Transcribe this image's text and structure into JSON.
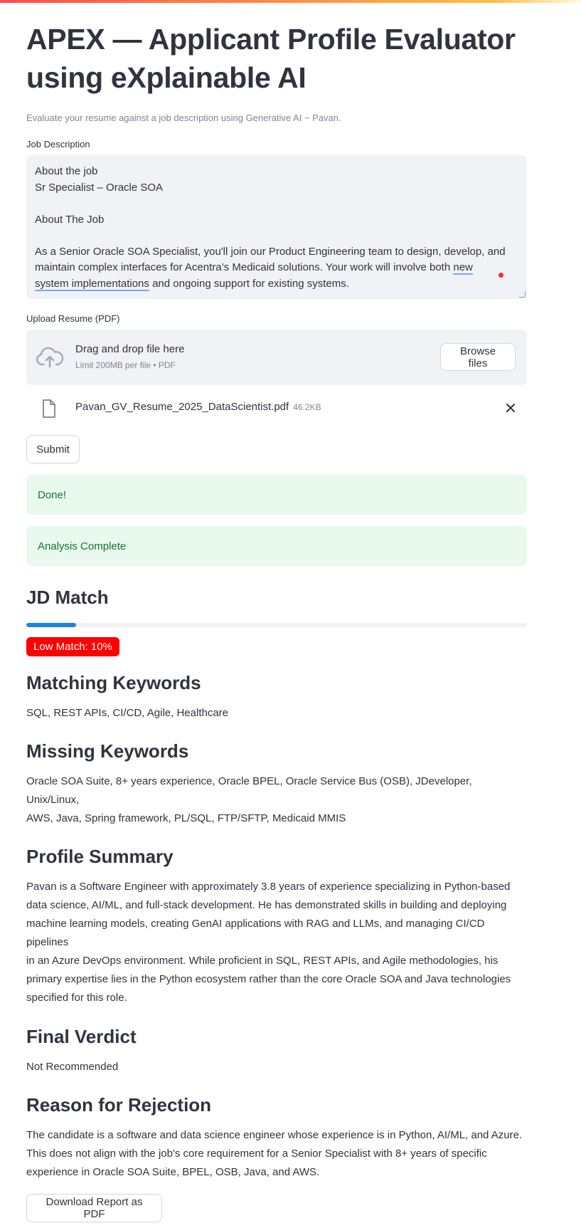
{
  "app": {
    "title": "APEX — Applicant Profile Evaluator using eXplainable AI",
    "caption": "Evaluate your resume against a job description using Generative AI ~ Pavan."
  },
  "job_description": {
    "label": "Job Description",
    "lines": [
      "About the job",
      "Sr Specialist – Oracle SOA",
      "",
      "About The Job",
      "",
      "As a Senior Oracle SOA Specialist, you'll join our Product Engineering team to design, develop, and",
      "maintain complex interfaces for Acentra’s Medicaid solutions. Your work will involve both",
      "new",
      "system implementations",
      "and ongoing support for existing systems."
    ]
  },
  "upload": {
    "label": "Upload Resume (PDF)",
    "drag_text": "Drag and drop file here",
    "limit_text": "Limit 200MB per file • PDF",
    "browse_label": "Browse files",
    "cloud_icon": "cloud-upload-icon",
    "file": {
      "name": "Pavan_GV_Resume_2025_DataScientist.pdf",
      "size": "46.2KB",
      "icon": "file-icon",
      "remove_icon": "close-icon"
    }
  },
  "submit_label": "Submit",
  "alerts": {
    "done": "Done!",
    "complete": "Analysis Complete"
  },
  "jd_match": {
    "heading": "JD Match",
    "progress_percent": 10,
    "badge": "Low Match: 10%",
    "badge_color": "#ff0000",
    "progress_color": "#1c83e1"
  },
  "matching_keywords": {
    "heading": "Matching Keywords",
    "text": "SQL, REST APIs, CI/CD, Agile, Healthcare"
  },
  "missing_keywords": {
    "heading": "Missing Keywords",
    "line1": "Oracle SOA Suite, 8+ years experience, Oracle BPEL, Oracle Service Bus (OSB), JDeveloper, Unix/Linux,",
    "line2": "AWS, Java, Spring framework, PL/SQL, FTP/SFTP, Medicaid MMIS"
  },
  "profile_summary": {
    "heading": "Profile Summary",
    "lines": [
      "Pavan is a Software Engineer with approximately 3.8 years of experience specializing in Python-based",
      "data science, AI/ML, and full-stack development. He has demonstrated skills in building and deploying",
      "machine learning models, creating GenAI applications with RAG and LLMs, and managing CI/CD pipelines",
      "in an Azure DevOps environment. While proficient in SQL, REST APIs, and Agile methodologies, his",
      "primary expertise lies in the Python ecosystem rather than the core Oracle SOA and Java technologies",
      "specified for this role."
    ]
  },
  "final_verdict": {
    "heading": "Final Verdict",
    "text": "Not Recommended"
  },
  "rejection": {
    "heading": "Reason for Rejection",
    "lines": [
      "The candidate is a software and data science engineer whose experience is in Python, AI/ML, and Azure.",
      "This does not align with the job's core requirement for a Senior Specialist with 8+ years of specific",
      "experience in Oracle SOA Suite, BPEL, OSB, Java, and AWS."
    ]
  },
  "download_label": "Download Report as PDF"
}
